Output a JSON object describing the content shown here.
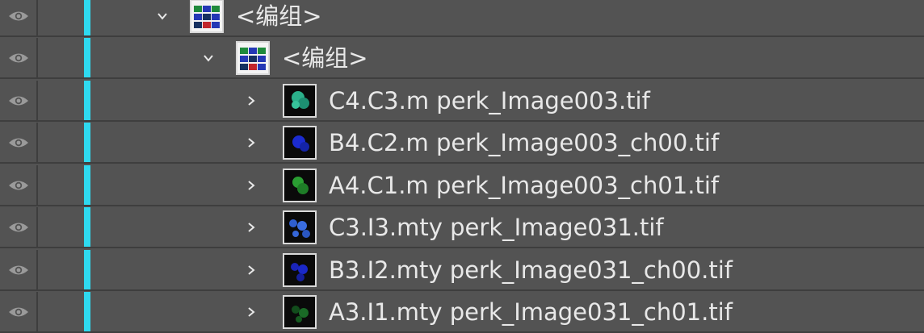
{
  "layers": [
    {
      "label": "<编组>",
      "expanded": true,
      "kind": "group"
    },
    {
      "label": "<编组>",
      "expanded": true,
      "kind": "group"
    },
    {
      "label": "C4.C3.m perk_Image003.tif",
      "expanded": false,
      "kind": "cyan-green"
    },
    {
      "label": "B4.C2.m perk_Image003_ch00.tif",
      "expanded": false,
      "kind": "blue"
    },
    {
      "label": "A4.C1.m perk_Image003_ch01.tif",
      "expanded": false,
      "kind": "green"
    },
    {
      "label": "C3.I3.mty perk_Image031.tif",
      "expanded": false,
      "kind": "blue-cells"
    },
    {
      "label": "B3.I2.mty perk_Image031_ch00.tif",
      "expanded": false,
      "kind": "blue"
    },
    {
      "label": "A3.I1.mty perk_Image031_ch01.tif",
      "expanded": false,
      "kind": "dark-green"
    }
  ],
  "colors": {
    "layer_color_bar": "#2fdaf0",
    "panel_bg": "#535353"
  },
  "icons": {
    "visibility": "eye-icon",
    "expand": "chevron-icon"
  }
}
